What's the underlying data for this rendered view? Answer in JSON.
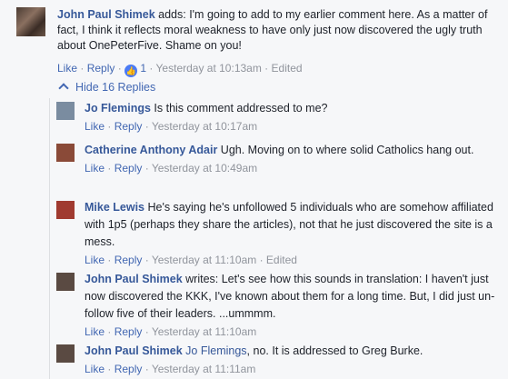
{
  "main_comment": {
    "author": "John Paul Shimek",
    "text": " adds: I'm going to add to my earlier comment here. As a matter of fact, I think it reflects moral weakness to have only just now discovered the ugly truth about OnePeterFive. Shame on you!",
    "actions": {
      "like": "Like",
      "reply": "Reply",
      "reaction_count": "1",
      "time": "Yesterday at 10:13am",
      "edited": "Edited"
    }
  },
  "hide_replies": "Hide 16 Replies",
  "replies": [
    {
      "author": "Jo Flemings",
      "text": " Is this comment addressed to me?",
      "like": "Like",
      "reply": "Reply",
      "time": "Yesterday at 10:17am",
      "edited": ""
    },
    {
      "author": "Catherine Anthony Adair",
      "text": " Ugh. Moving on to where solid Catholics hang out.",
      "like": "Like",
      "reply": "Reply",
      "time": "Yesterday at 10:49am",
      "edited": ""
    },
    {
      "author": "Mike Lewis",
      "text": " He's saying he's unfollowed 5 individuals who are somehow affiliated with 1p5 (perhaps they share the articles), not that he just discovered the site is a mess.",
      "like": "Like",
      "reply": "Reply",
      "time": "Yesterday at 11:10am",
      "edited": "Edited"
    },
    {
      "author": "John Paul Shimek",
      "text": " writes: Let's see how this sounds in translation: I haven't just now discovered the KKK, I've known about them for a long time. But, I did just un-follow five of their leaders. ...ummmm.",
      "like": "Like",
      "reply": "Reply",
      "time": "Yesterday at 11:10am",
      "edited": ""
    },
    {
      "author": "John Paul Shimek",
      "mention": "Jo Flemings",
      "text": ", no. It is addressed to Greg Burke.",
      "like": "Like",
      "reply": "Reply",
      "time": "Yesterday at 11:11am",
      "edited": ""
    }
  ]
}
